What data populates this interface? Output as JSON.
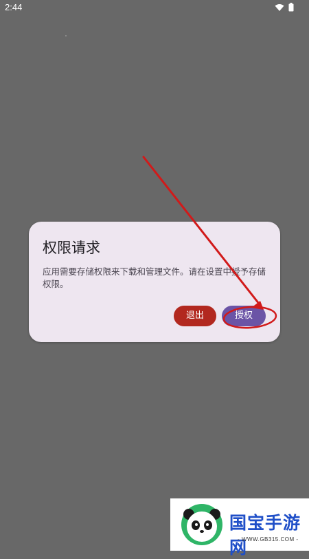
{
  "status_bar": {
    "time": "2:44",
    "icons": [
      "wifi-icon",
      "battery-icon"
    ]
  },
  "dialog": {
    "title": "权限请求",
    "message": "应用需要存储权限来下载和管理文件。请在设置中授予存储权限。",
    "buttons": {
      "exit_label": "退出",
      "grant_label": "授权"
    }
  },
  "colors": {
    "scrim": "#686868",
    "dialog_bg": "#eee6f0",
    "exit_button": "#b2281f",
    "grant_button": "#6b54a6",
    "annotation": "#d11a1a"
  },
  "watermark": {
    "title": "国宝手游网",
    "url": "- WWW.GB315.COM -"
  }
}
